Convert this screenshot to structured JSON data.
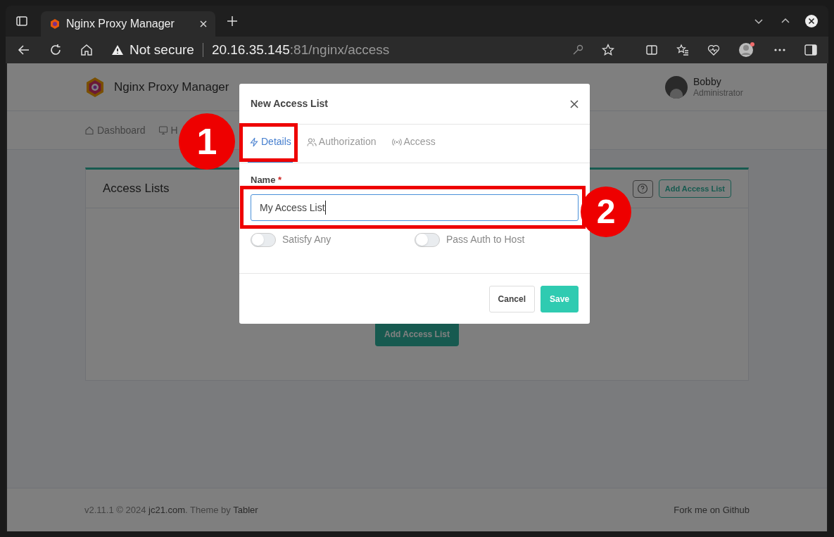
{
  "browser": {
    "tab_title": "Nginx Proxy Manager",
    "security": "Not secure",
    "url_host": "20.16.35.145",
    "url_path": ":81/nginx/access"
  },
  "header": {
    "brand": "Nginx Proxy Manager",
    "user_name": "Bobby",
    "user_role": "Administrator"
  },
  "nav": [
    {
      "label": "Dashboard"
    },
    {
      "label": "H"
    }
  ],
  "card": {
    "title": "Access Lists",
    "header_button": "Add Access List",
    "empty_button": "Add Access List"
  },
  "footer": {
    "left": [
      {
        "text": "v2.11.1 © 2024 ",
        "link": false
      },
      {
        "text": "jc21.com",
        "link": true
      },
      {
        "text": ". Theme by ",
        "link": false
      },
      {
        "text": "Tabler",
        "link": true
      }
    ],
    "right": "Fork me on Github"
  },
  "modal": {
    "title": "New Access List",
    "tabs": [
      {
        "label": "Details",
        "selected": true
      },
      {
        "label": "Authorization",
        "selected": false
      },
      {
        "label": "Access",
        "selected": false
      }
    ],
    "name_label": "Name",
    "required": "*",
    "name_value": "My Access List",
    "toggles": [
      {
        "label": "Satisfy Any",
        "on": false
      },
      {
        "label": "Pass Auth to Host",
        "on": false
      }
    ],
    "buttons": [
      {
        "label": "Cancel",
        "kind": "secondary"
      },
      {
        "label": "Save",
        "kind": "primary"
      }
    ]
  },
  "annotations": [
    {
      "number": "1"
    },
    {
      "number": "2"
    }
  ]
}
